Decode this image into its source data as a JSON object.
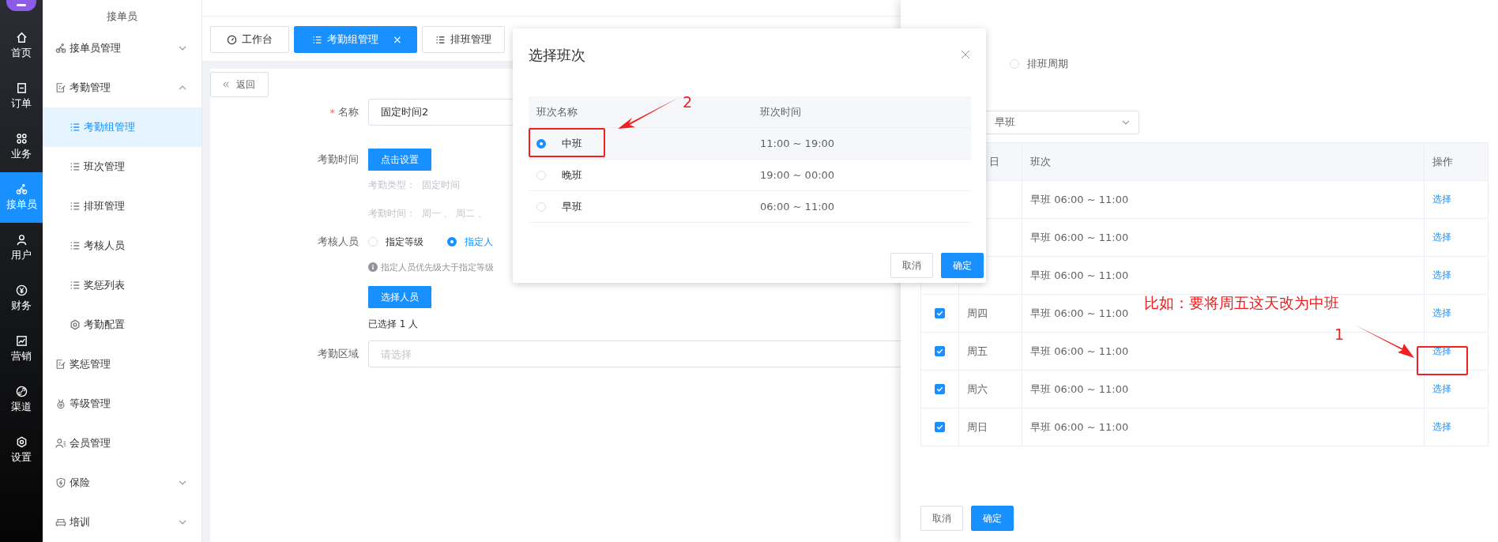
{
  "rail": [
    {
      "label": "首页",
      "selected": false
    },
    {
      "label": "订单",
      "selected": false
    },
    {
      "label": "业务",
      "selected": false
    },
    {
      "label": "接单员",
      "selected": true
    },
    {
      "label": "用户",
      "selected": false
    },
    {
      "label": "财务",
      "selected": false
    },
    {
      "label": "营销",
      "selected": false
    },
    {
      "label": "渠道",
      "selected": false
    },
    {
      "label": "设置",
      "selected": false
    }
  ],
  "submenu": {
    "title": "接单员",
    "items": [
      {
        "kind": "group",
        "label": "接单员管理",
        "expanded": false
      },
      {
        "kind": "group",
        "label": "考勤管理",
        "expanded": true,
        "children": [
          {
            "label": "考勤组管理",
            "selected": true
          },
          {
            "label": "班次管理",
            "selected": false
          },
          {
            "label": "排班管理",
            "selected": false
          },
          {
            "label": "考核人员",
            "selected": false
          },
          {
            "label": "奖惩列表",
            "selected": false
          },
          {
            "label": "考勤配置",
            "selected": false
          }
        ]
      },
      {
        "kind": "link",
        "label": "奖惩管理",
        "selected": false
      },
      {
        "kind": "link",
        "label": "等级管理",
        "selected": false
      },
      {
        "kind": "link",
        "label": "会员管理",
        "selected": false
      },
      {
        "kind": "group",
        "label": "保险",
        "expanded": false
      },
      {
        "kind": "group",
        "label": "培训",
        "expanded": false
      }
    ]
  },
  "tabs": [
    {
      "label": "工作台",
      "selected": false
    },
    {
      "label": "考勤组管理",
      "selected": true,
      "close": "×"
    },
    {
      "label": "排班管理",
      "selected": false
    }
  ],
  "form": {
    "back": "返回",
    "name": {
      "label": "名称",
      "required_mark": "*",
      "value": "固定时间2"
    },
    "time": {
      "label": "考勤时间",
      "button": "点击设置",
      "type_label": "考勤类型：",
      "type_value": "固定时间",
      "days_label": "考勤时间：",
      "days_value": "周一 、 周二 、"
    },
    "members": {
      "label": "考核人员",
      "options": [
        {
          "label": "指定等级",
          "selected": false
        },
        {
          "label": "指定人",
          "selected": true
        }
      ],
      "hint": "指定人员优先级大于指定等级",
      "button": "选择人员",
      "count": "已选择 1 人"
    },
    "area": {
      "label": "考勤区域",
      "placeholder": "请选择"
    }
  },
  "drawer": {
    "cycle_option": {
      "label": "排班周期",
      "selected": false
    },
    "shift_select": {
      "value": "早班"
    },
    "table": {
      "columns": [
        "日",
        "班次",
        "操作"
      ],
      "rows": [
        {
          "shift": "早班 06:00 ~ 11:00",
          "action": "选择"
        },
        {
          "shift": "早班 06:00 ~ 11:00",
          "action": "选择"
        },
        {
          "shift": "早班 06:00 ~ 11:00",
          "action": "选择"
        },
        {
          "checked": true,
          "day": "周四",
          "shift": "早班 06:00 ~ 11:00",
          "action": "选择"
        },
        {
          "checked": true,
          "day": "周五",
          "shift": "早班 06:00 ~ 11:00",
          "action": "选择"
        },
        {
          "checked": true,
          "day": "周六",
          "shift": "早班 06:00 ~ 11:00",
          "action": "选择"
        },
        {
          "checked": true,
          "day": "周日",
          "shift": "早班 06:00 ~ 11:00",
          "action": "选择"
        }
      ]
    },
    "buttons": [
      "取消",
      "确定"
    ]
  },
  "dialog": {
    "title": "选择班次",
    "columns": [
      "班次名称",
      "班次时间"
    ],
    "rows": [
      {
        "name": "中班",
        "time": "11:00 ~ 19:00",
        "selected": true
      },
      {
        "name": "晚班",
        "time": "19:00 ~ 00:00",
        "selected": false
      },
      {
        "name": "早班",
        "time": "06:00 ~ 11:00",
        "selected": false
      }
    ],
    "buttons": [
      "取消",
      "确定"
    ]
  },
  "annotations": {
    "note": "比如：要将周五这天改为中班",
    "marker_1": "1",
    "marker_2": "2"
  }
}
